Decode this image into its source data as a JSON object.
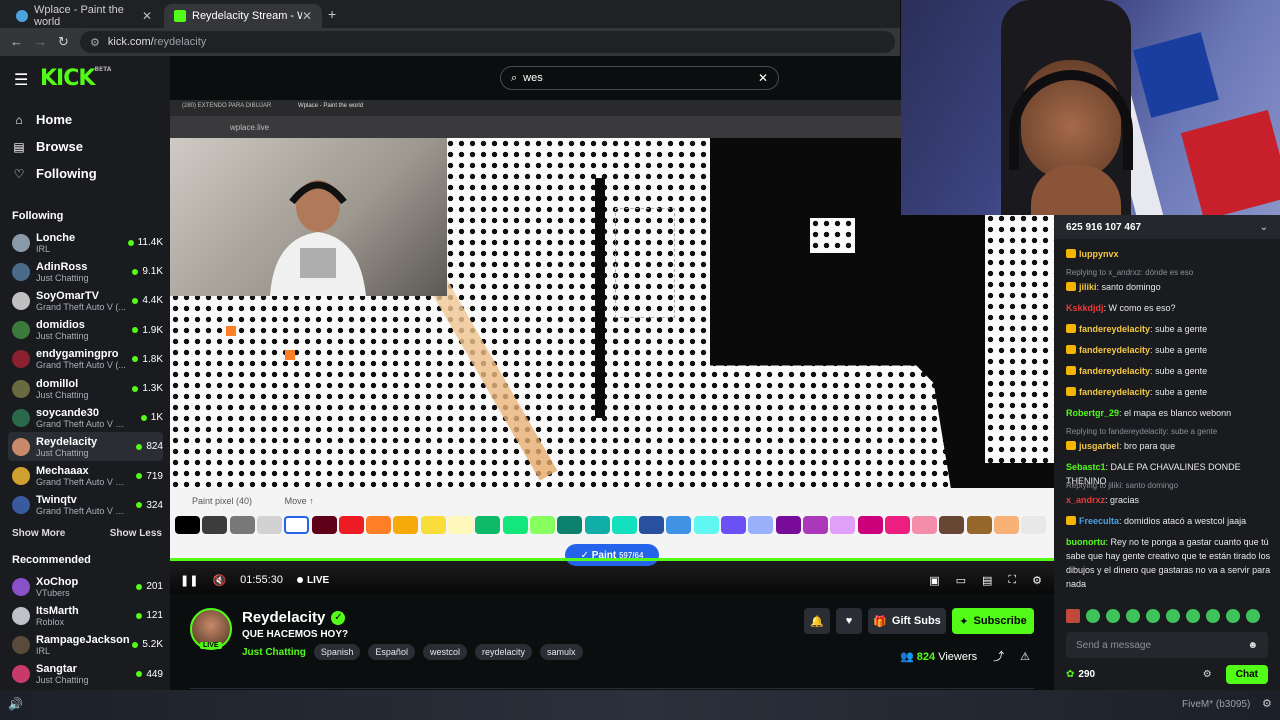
{
  "browser": {
    "tabs": [
      {
        "title": "Wplace - Paint the world",
        "fav_color": "#4aa3df"
      },
      {
        "title": "Reydelacity Stream - Watch Liv",
        "fav_color": "#53fc18"
      }
    ],
    "url_host": "kick.com/",
    "url_path": "reydelacity"
  },
  "kick": {
    "logo": "KICK",
    "logo_beta": "BETA",
    "nav": [
      {
        "label": "Home",
        "icon": "⌂"
      },
      {
        "label": "Browse",
        "icon": "▤"
      },
      {
        "label": "Following",
        "icon": "♡"
      }
    ],
    "following_title": "Following",
    "following": [
      {
        "name": "Lonche",
        "category": "IRL",
        "viewers": "11.4K",
        "color": "#8a9aa8"
      },
      {
        "name": "AdinRoss",
        "category": "Just Chatting",
        "viewers": "9.1K",
        "color": "#4a6a8a"
      },
      {
        "name": "SoyOmarTV",
        "category": "Grand Theft Auto V (...",
        "viewers": "4.4K",
        "color": "#c0c0c0"
      },
      {
        "name": "domidios",
        "category": "Just Chatting",
        "viewers": "1.9K",
        "color": "#3c7a3c"
      },
      {
        "name": "endygamingpro",
        "category": "Grand Theft Auto V (...",
        "viewers": "1.8K",
        "color": "#8a2030"
      },
      {
        "name": "domillol",
        "category": "Just Chatting",
        "viewers": "1.3K",
        "color": "#6a6a40"
      },
      {
        "name": "soycande30",
        "category": "Grand Theft Auto V (GTA)",
        "viewers": "1K",
        "color": "#2a6a4a"
      },
      {
        "name": "Reydelacity",
        "category": "Just Chatting",
        "viewers": "824",
        "color": "#c88a6a"
      },
      {
        "name": "Mechaaax",
        "category": "Grand Theft Auto V (G...",
        "viewers": "719",
        "color": "#d0a030"
      },
      {
        "name": "Twinqtv",
        "category": "Grand Theft Auto V (G...",
        "viewers": "324",
        "color": "#3a5aa0"
      }
    ],
    "show_more": "Show More",
    "show_less": "Show Less",
    "recommended_title": "Recommended",
    "recommended": [
      {
        "name": "XoChop",
        "category": "VTubers",
        "viewers": "201",
        "color": "#8a50c8"
      },
      {
        "name": "ItsMarth",
        "category": "Roblox",
        "viewers": "121",
        "color": "#c0c0c8"
      },
      {
        "name": "RampageJackson",
        "category": "IRL",
        "viewers": "5.2K",
        "color": "#5a4a3a"
      },
      {
        "name": "Sangtar",
        "category": "Just Chatting",
        "viewers": "449",
        "color": "#c83a6a"
      }
    ],
    "search_value": "wes"
  },
  "video": {
    "inner_tabs": [
      "(280) EXTENDO PARA DIBUJAR",
      "Wplace - Paint the world"
    ],
    "inner_url": "wplace.live",
    "palette_title": "Paint pixel",
    "palette_count": "(40)",
    "palette_move": "Move ↑",
    "palette_colors": [
      "#000000",
      "#3c3c3c",
      "#787878",
      "#d2d2d2",
      "#ffffff",
      "#600018",
      "#ed1c24",
      "#ff7f27",
      "#f6aa09",
      "#f9dd3b",
      "#fffabc",
      "#0eb968",
      "#13e67b",
      "#87ff5e",
      "#0c816e",
      "#10aea6",
      "#13e1be",
      "#28509e",
      "#4093e4",
      "#60f7f2",
      "#6b50f6",
      "#99b1fb",
      "#780c99",
      "#aa38b9",
      "#e09ff9",
      "#cb007a",
      "#ec1f80",
      "#f38da9",
      "#684634",
      "#95682a",
      "#f8b277",
      "#e8e8e8"
    ],
    "paint_label": "✓ Paint",
    "paint_count": "597/64",
    "time": "01:55:30",
    "live": "LIVE"
  },
  "stream": {
    "name": "Reydelacity",
    "live_tag": "LIVE",
    "title": "QUE HACEMOS HOY?",
    "category": "Just Chatting",
    "tags": [
      "Spanish",
      "Español",
      "westcol",
      "reydelacity",
      "samulx"
    ],
    "gift_subs": "Gift Subs",
    "subscribe": "Subscribe",
    "viewers": "824",
    "viewers_label": "Viewers"
  },
  "chat": {
    "pinned": "625 916 107 467",
    "messages": [
      {
        "user": "luppynvx",
        "text": "",
        "color": "#f5c842",
        "badge": true
      },
      {
        "reply": "Replying to x_andrxz: dónde es eso"
      },
      {
        "user": "jiliki",
        "text": "santo domingo",
        "color": "#f5c842",
        "badge": true
      },
      {
        "user": "Kskkdjdj",
        "text": "W como es eso?",
        "color": "#e83a3a",
        "badge": false
      },
      {
        "user": "fandereydelacity",
        "text": "sube a gente",
        "color": "#f5c842",
        "badge": true
      },
      {
        "user": "fandereydelacity",
        "text": "sube a gente",
        "color": "#f5c842",
        "badge": true
      },
      {
        "user": "fandereydelacity",
        "text": "sube a gente",
        "color": "#f5c842",
        "badge": true
      },
      {
        "user": "fandereydelacity",
        "text": "sube a gente",
        "color": "#f5c842",
        "badge": true
      },
      {
        "user": "Robertgr_29",
        "text": "el mapa es blanco webonn",
        "color": "#53fc18",
        "badge": false
      },
      {
        "reply": "Replying to fandereydelacity: sube a gente"
      },
      {
        "user": "jusgarbel",
        "text": "bro para que",
        "color": "#f5c842",
        "badge": true
      },
      {
        "user": "Sebastc1",
        "text": "DALE PA CHAVALINES DONDE THENINO",
        "color": "#53fc18",
        "badge": false
      },
      {
        "reply": "Replying to jiliki: santo domingo"
      },
      {
        "user": "x_andrxz",
        "text": "gracias",
        "color": "#e83a3a",
        "badge": false
      },
      {
        "user": "Freeculta",
        "text": "domidios atacó a westcol jaaja",
        "color": "#4aa3df",
        "badge": true
      },
      {
        "user": "buonortu",
        "text": "Rey no te ponga a gastar cuanto que tú sabe que hay gente creativo que te están tirado los dibujos y el dinero que gastaras no va a servir para nada",
        "color": "#53fc18",
        "badge": false
      }
    ],
    "input_placeholder": "Send a message",
    "points": "290",
    "chat_button": "Chat"
  },
  "taskbar": {
    "fivem": "FiveM* (b3095)"
  }
}
